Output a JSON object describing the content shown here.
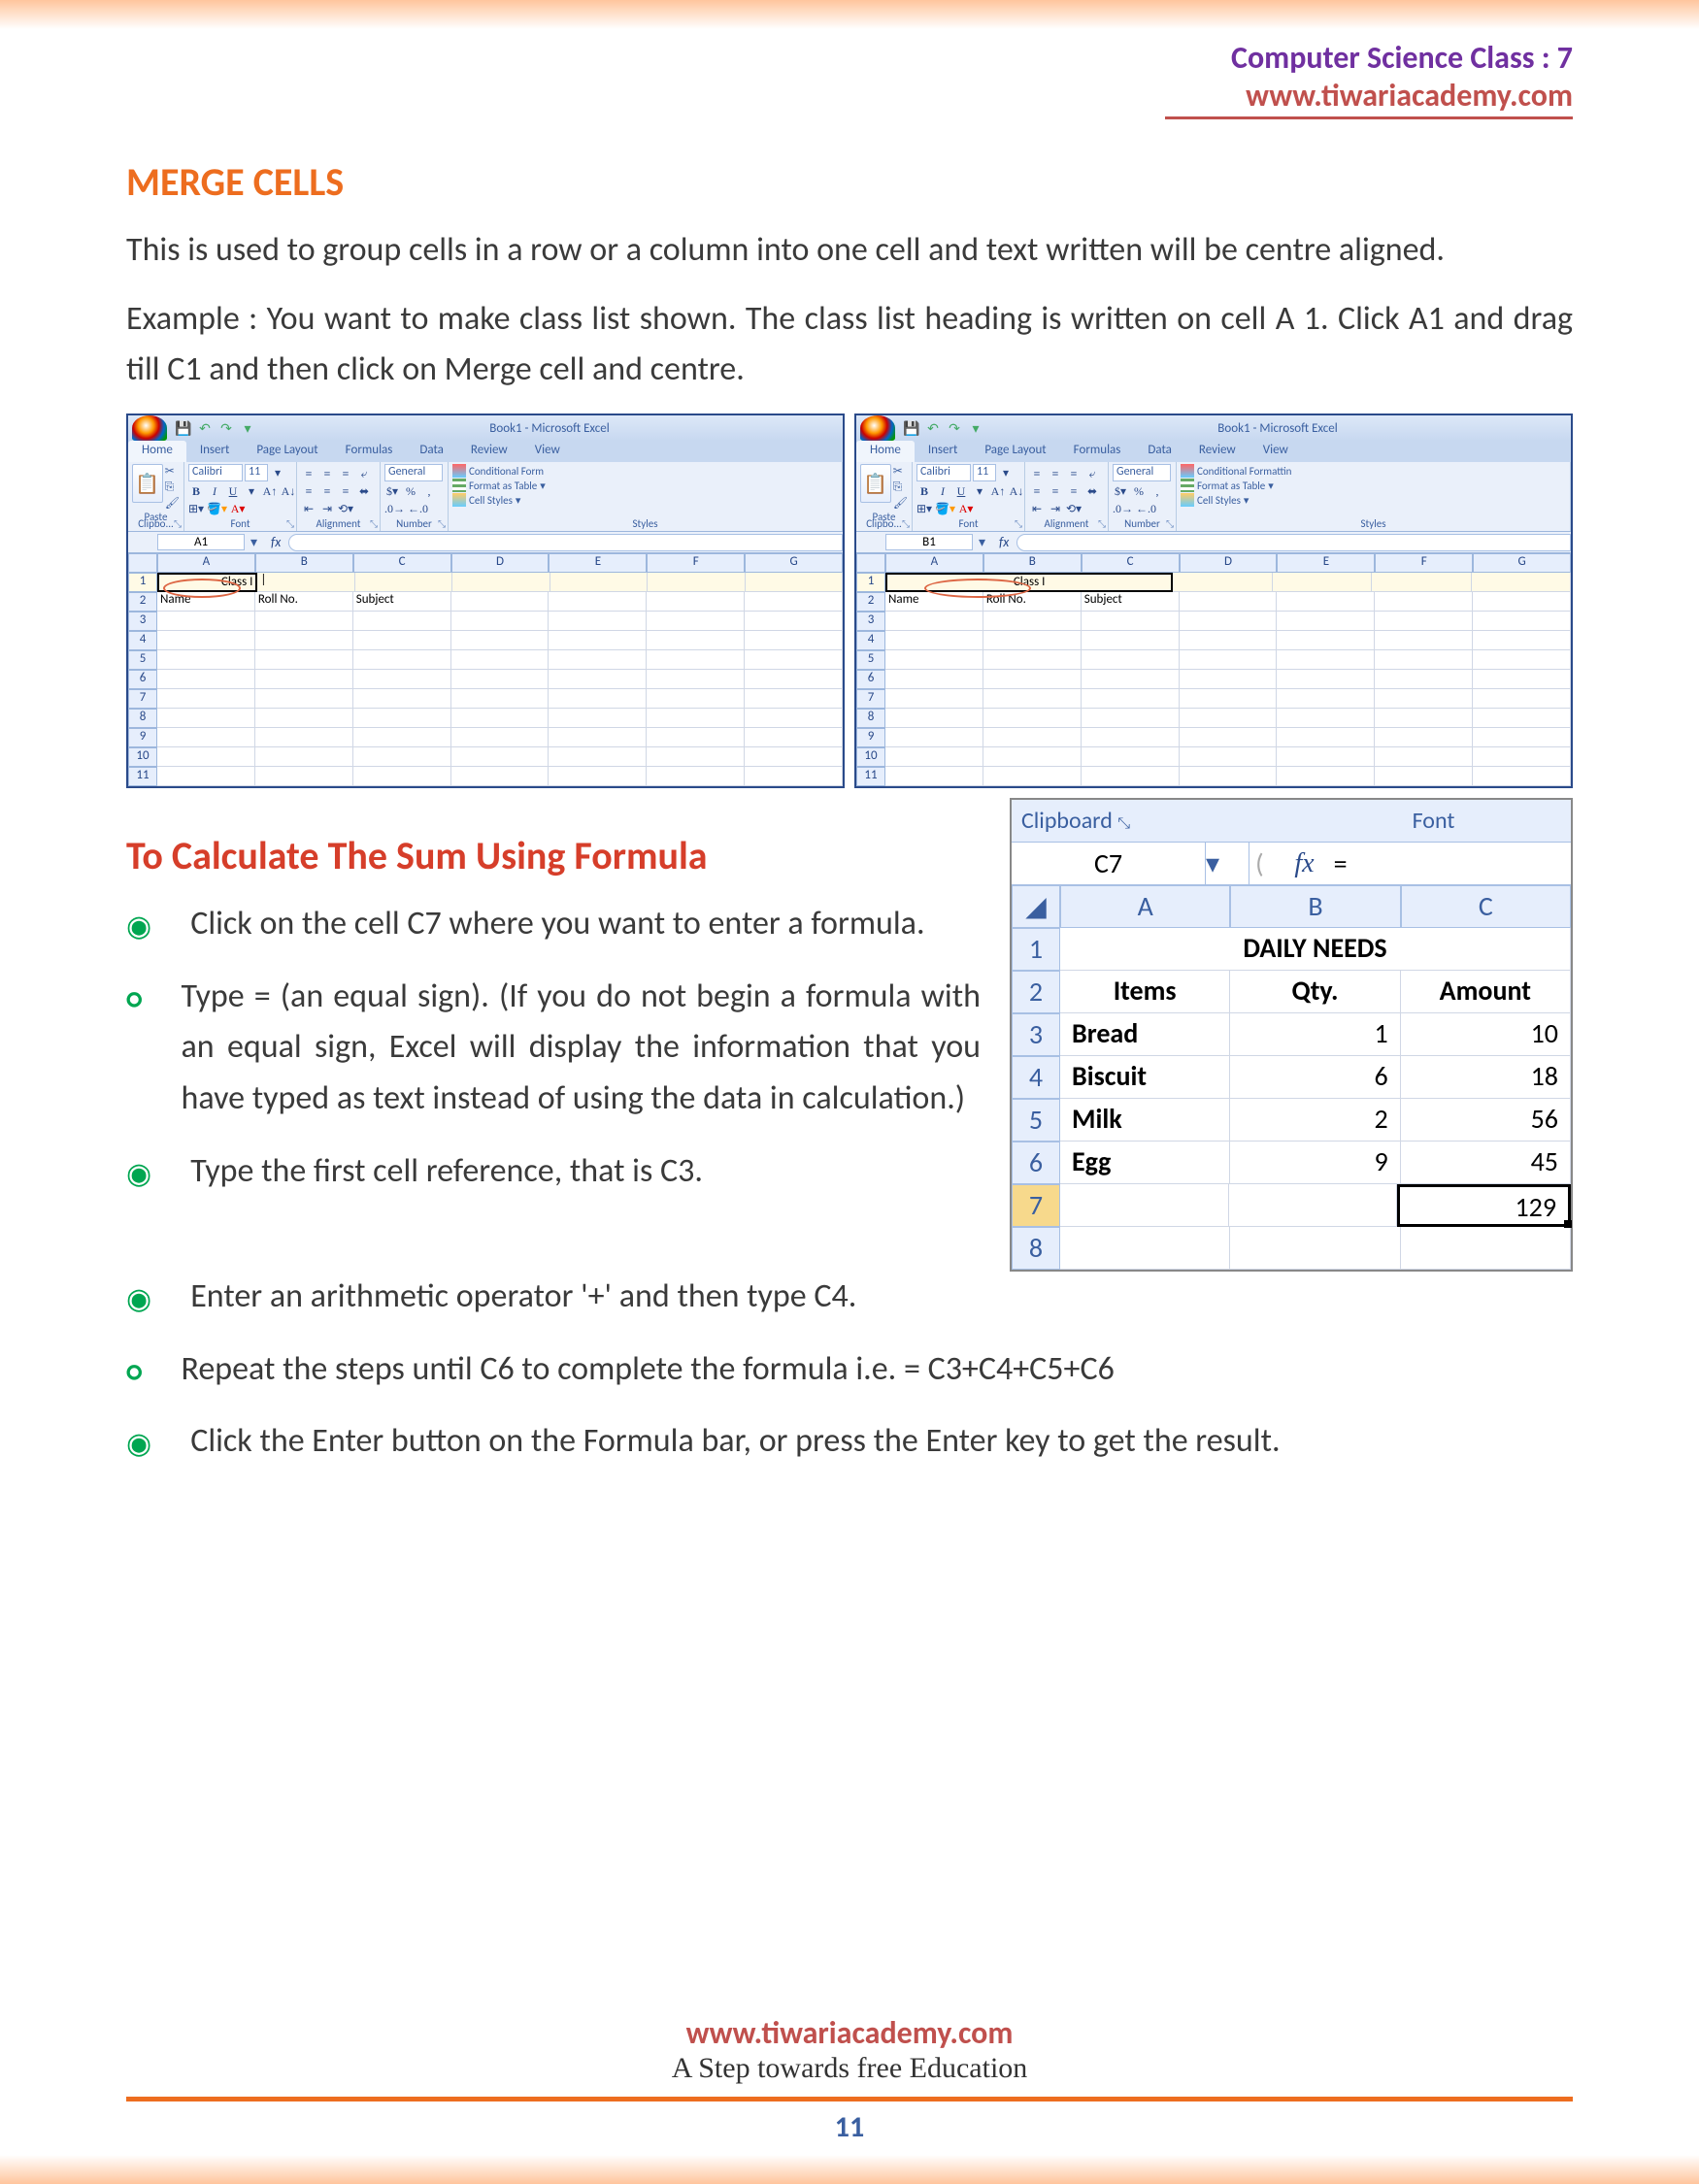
{
  "header": {
    "title": "Computer Science Class : 7",
    "url": "www.tiwariacademy.com"
  },
  "section1": {
    "heading": "MERGE CELLS",
    "p1": "This is used to group cells in a row or a column into one cell and text written will be centre aligned.",
    "p2": "Example : You want to make class list shown. The class list heading is written on cell A 1. Click A1 and drag till C1 and then click on Merge cell and centre."
  },
  "excel": {
    "title": "Book1 - Microsoft Excel",
    "tabs": [
      "Home",
      "Insert",
      "Page Layout",
      "Formulas",
      "Data",
      "Review",
      "View"
    ],
    "groups": {
      "clipboard": "Clipbo...",
      "font": "Font",
      "alignment": "Alignment",
      "number": "Number",
      "styles": "Styles"
    },
    "paste": "Paste",
    "fontname": "Calibri",
    "fontsize": "11",
    "numfmt": "General",
    "styleslbl": {
      "cond": "Conditional Formattin",
      "condshort": "Conditional Form",
      "table": "Format as Table",
      "cell": "Cell Styles"
    },
    "cols": [
      "A",
      "B",
      "C",
      "D",
      "E",
      "F",
      "G"
    ],
    "left": {
      "namebox": "A1",
      "row1": "Class I",
      "row2": [
        "Name",
        "Roll No.",
        "Subject"
      ]
    },
    "right": {
      "namebox": "B1",
      "row1": "Class I",
      "row2": [
        "Name",
        "Roll No.",
        "Subject"
      ]
    }
  },
  "section2": {
    "heading": "To Calculate The Sum Using Formula",
    "bullets": [
      "Click on the cell C7 where you want to enter a formula.",
      "Type = (an equal sign). (If you do not begin a formula with an equal sign, Excel will display the information that you have typed as text instead of using the data in calculation.)",
      "Type the first cell reference, that is C3.",
      "Enter an arithmetic operator '+' and then type C4.",
      "Repeat the steps until C6 to complete the formula i.e. = C3+C4+C5+C6",
      "Click the Enter button on the Formula bar, or press the Enter key to get the result."
    ]
  },
  "chart_data": {
    "type": "table",
    "clipboard": "Clipboard",
    "font": "Font",
    "cellref": "C7",
    "fx": "fx",
    "eq": "=",
    "cols": [
      "A",
      "B",
      "C"
    ],
    "title": "DAILY NEEDS",
    "headers": [
      "Items",
      "Qty.",
      "Amount"
    ],
    "rows": [
      {
        "item": "Bread",
        "qty": 1,
        "amount": 10
      },
      {
        "item": "Biscuit",
        "qty": 6,
        "amount": 18
      },
      {
        "item": "Milk",
        "qty": 2,
        "amount": 56
      },
      {
        "item": "Egg",
        "qty": 9,
        "amount": 45
      }
    ],
    "total": 129
  },
  "footer": {
    "url": "www.tiwariacademy.com",
    "tag": "A Step towards free Education",
    "page": "11"
  }
}
